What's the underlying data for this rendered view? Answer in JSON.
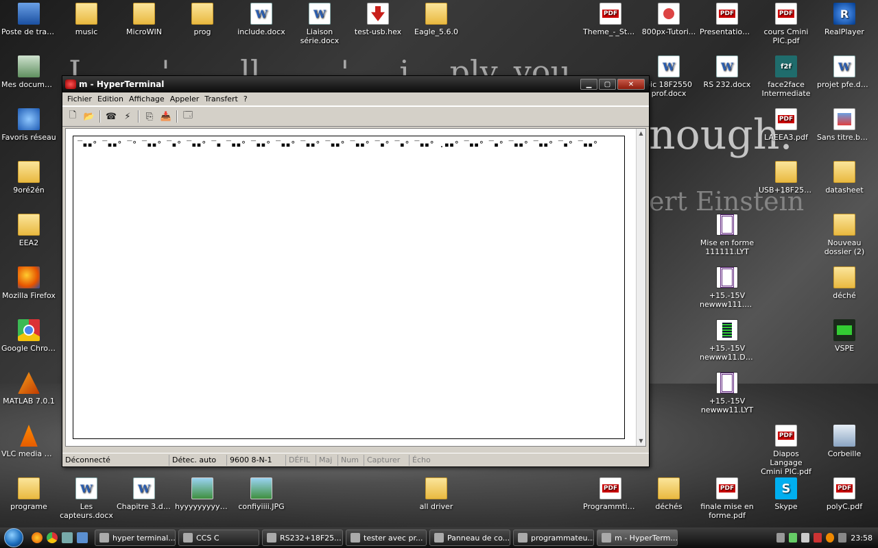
{
  "wallpaper": {
    "quote_line1": "I        '       ll        ' ,   i    ply, you",
    "quote_line2": "nough.",
    "quote_author": "ert Einstein"
  },
  "desktop_icons": [
    {
      "label": "Poste de travail",
      "icon": "computer-icon"
    },
    {
      "label": "music",
      "icon": "folder-icon"
    },
    {
      "label": "MicroWIN",
      "icon": "folder-icon"
    },
    {
      "label": "prog",
      "icon": "folder-icon"
    },
    {
      "label": "include.docx",
      "icon": "word-document-icon"
    },
    {
      "label": "Liaison série.docx",
      "icon": "word-document-icon"
    },
    {
      "label": "test-usb.hex",
      "icon": "hex-file-icon"
    },
    {
      "label": "Eagle_5.6.0",
      "icon": "folder-icon"
    },
    {
      "label": "Theme_-_Stat...",
      "icon": "pdf-icon"
    },
    {
      "label": "800px-Tutori...",
      "icon": "ppt-icon"
    },
    {
      "label": "Presentation_...",
      "icon": "pdf-icon"
    },
    {
      "label": "cours Cmini PIC.pdf",
      "icon": "pdf-icon"
    },
    {
      "label": "RealPlayer",
      "icon": "realplayer-icon"
    },
    {
      "label": "Mes documents",
      "icon": "documents-icon"
    },
    {
      "label": "pic 18F2550 prof.docx",
      "icon": "word-document-icon"
    },
    {
      "label": "RS 232.docx",
      "icon": "word-document-icon"
    },
    {
      "label": "face2face Intermediate",
      "icon": "f2f-icon"
    },
    {
      "label": "projet pfe.docx",
      "icon": "word-document-icon"
    },
    {
      "label": "Favoris réseau",
      "icon": "network-icon"
    },
    {
      "label": "LAEEA3.pdf",
      "icon": "pdf-icon"
    },
    {
      "label": "Sans titre.bmp",
      "icon": "bmp-icon"
    },
    {
      "label": "9oré2én",
      "icon": "folder-icon"
    },
    {
      "label": "USB+18F2550",
      "icon": "folder-icon"
    },
    {
      "label": "datasheet",
      "icon": "folder-icon"
    },
    {
      "label": "EEA2",
      "icon": "folder-icon"
    },
    {
      "label": "Mise en forme 111111.LYT",
      "icon": "lyt-file-icon"
    },
    {
      "label": "Nouveau dossier (2)",
      "icon": "folder-icon"
    },
    {
      "label": "Mozilla Firefox",
      "icon": "firefox-icon"
    },
    {
      "label": "+15.-15V newww111.LYT",
      "icon": "lyt-file-icon"
    },
    {
      "label": "déché",
      "icon": "folder-icon"
    },
    {
      "label": "Google Chrome",
      "icon": "chrome-icon"
    },
    {
      "label": "+15.-15V newww11.DSN",
      "icon": "dsn-file-icon"
    },
    {
      "label": "VSPE",
      "icon": "vspe-icon"
    },
    {
      "label": "MATLAB 7.0.1",
      "icon": "matlab-icon"
    },
    {
      "label": "+15.-15V newww11.LYT",
      "icon": "lyt-file-icon"
    },
    {
      "label": "VLC media player",
      "icon": "vlc-icon"
    },
    {
      "label": "Diapos Langage Cmini PIC.pdf",
      "icon": "pdf-icon"
    },
    {
      "label": "Corbeille",
      "icon": "recycle-bin-icon"
    },
    {
      "label": "programe",
      "icon": "folder-icon"
    },
    {
      "label": "Les capteurs.docx",
      "icon": "word-document-icon"
    },
    {
      "label": "Chapitre 3.docx",
      "icon": "word-document-icon"
    },
    {
      "label": "hyyyyyyyyyy...",
      "icon": "image-icon"
    },
    {
      "label": "confiyiiii.JPG",
      "icon": "image-icon"
    },
    {
      "label": "all driver",
      "icon": "folder-icon"
    },
    {
      "label": "Programmtion...",
      "icon": "pdf-icon"
    },
    {
      "label": "déchés",
      "icon": "folder-icon"
    },
    {
      "label": "finale mise en forme.pdf",
      "icon": "pdf-icon"
    },
    {
      "label": "Skype",
      "icon": "skype-icon"
    },
    {
      "label": "polyC.pdf",
      "icon": "pdf-icon"
    }
  ],
  "window": {
    "title": "m - HyperTerminal",
    "menu": [
      "Fichier",
      "Edition",
      "Affichage",
      "Appeler",
      "Transfert",
      "?"
    ],
    "toolbar": [
      "new-icon",
      "open-icon",
      "call-icon",
      "disconnect-icon",
      "send-icon",
      "receive-icon",
      "properties-icon"
    ],
    "terminal_text": "‾▪▪° ‾▪▪° ‾° ‾▪▪° ‾▪° ‾▪▪° ‾▪ ‾▪▪° ‾▪▪° ‾▪▪° ‾▪▪° ‾▪▪° ‾▪▪° ‾▪° ‾▪° ‾▪▪° .▪▪° ‾▪▪° ‾▪° ‾▪▪° ‾▪▪° ‾▪° ‾▪▪°",
    "status": {
      "connection": "Déconnecté",
      "detect": "Détec. auto",
      "settings": "9600 8-N-1",
      "defil": "DÉFIL",
      "maj": "Maj",
      "num": "Num",
      "capture": "Capturer",
      "echo": "Écho"
    }
  },
  "taskbar": {
    "tasks": [
      {
        "label": "hyper terminal...",
        "icon": "chrome-icon",
        "active": false
      },
      {
        "label": "CCS C",
        "icon": "ccs-icon",
        "active": false
      },
      {
        "label": "RS232+18F25...",
        "icon": "isis-icon",
        "active": false
      },
      {
        "label": "tester avec pr...",
        "icon": "explorer-icon",
        "active": false
      },
      {
        "label": "Panneau de co...",
        "icon": "control-panel-icon",
        "active": false
      },
      {
        "label": "programmateu...",
        "icon": "word-icon",
        "active": false
      },
      {
        "label": "m - HyperTerm...",
        "icon": "hyperterminal-icon",
        "active": true
      }
    ],
    "clock": "23:58"
  }
}
